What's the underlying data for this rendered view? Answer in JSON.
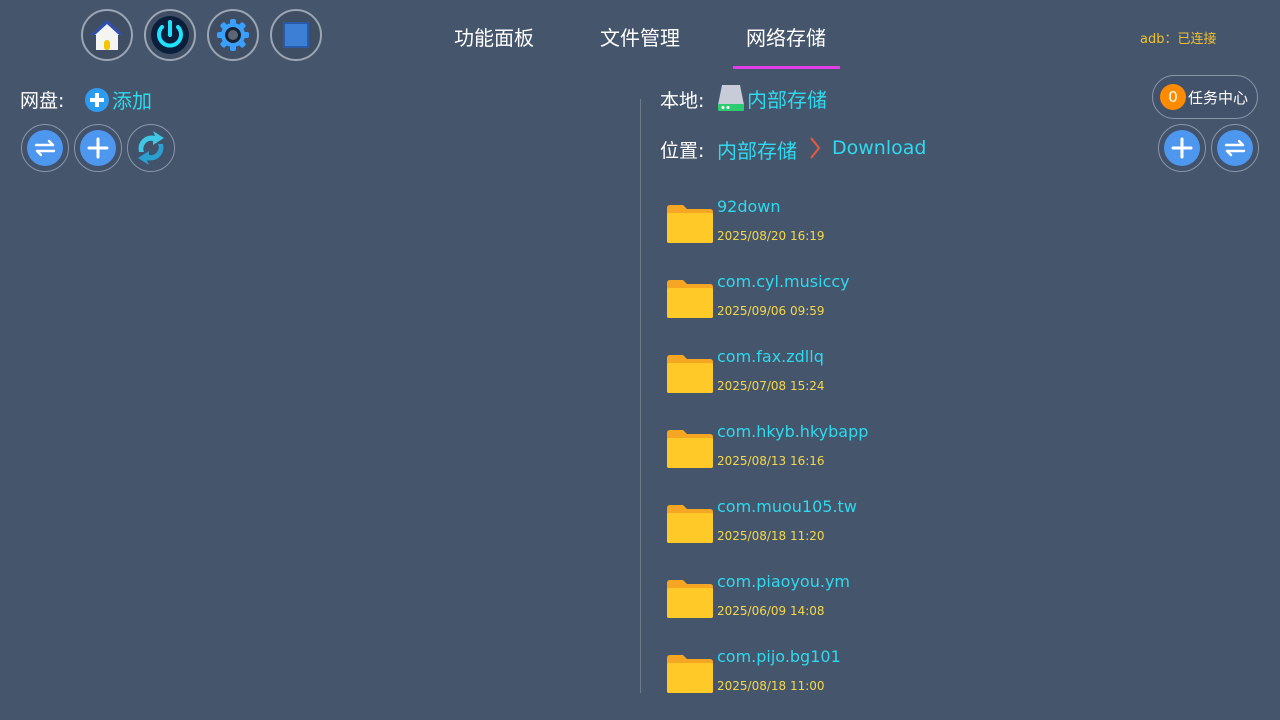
{
  "toolbar": {
    "buttons": [
      {
        "name": "home",
        "icon": "home-icon"
      },
      {
        "name": "power",
        "icon": "power-icon"
      },
      {
        "name": "settings",
        "icon": "gear-icon"
      },
      {
        "name": "stop",
        "icon": "stop-square-icon"
      }
    ]
  },
  "tabs": [
    {
      "label": "功能面板"
    },
    {
      "label": "文件管理"
    },
    {
      "label": "网络存储",
      "active": true
    }
  ],
  "status": {
    "adb": "adb：已连接"
  },
  "left": {
    "netdisk_label": "网盘:",
    "add_label": "添加",
    "actions": [
      "swap-icon",
      "plus-icon",
      "refresh-icon"
    ]
  },
  "right": {
    "local_label": "本地:",
    "storage_name": "内部存储",
    "location_label": "位置:",
    "breadcrumb": [
      "内部存储",
      "Download"
    ],
    "task_center": {
      "count": "0",
      "label": "任务中心"
    },
    "actions": [
      "plus-icon",
      "swap-icon"
    ],
    "files": [
      {
        "name": "92down",
        "date": "2025/08/20 16:19"
      },
      {
        "name": "com.cyl.musiccy",
        "date": "2025/09/06 09:59"
      },
      {
        "name": "com.fax.zdllq",
        "date": "2025/07/08 15:24"
      },
      {
        "name": "com.hkyb.hkybapp",
        "date": "2025/08/13 16:16"
      },
      {
        "name": "com.muou105.tw",
        "date": "2025/08/18 11:20"
      },
      {
        "name": "com.piaoyou.ym",
        "date": "2025/06/09 14:08"
      },
      {
        "name": "com.pijo.bg101",
        "date": "2025/08/18 11:00"
      }
    ]
  },
  "colors": {
    "background": "#45556b",
    "accent_cyan": "#2fd9ee",
    "date_yellow": "#f5d84a",
    "tab_underline": "#e040e8",
    "badge_orange": "#ff8c00",
    "button_blue": "#4e97ef"
  }
}
